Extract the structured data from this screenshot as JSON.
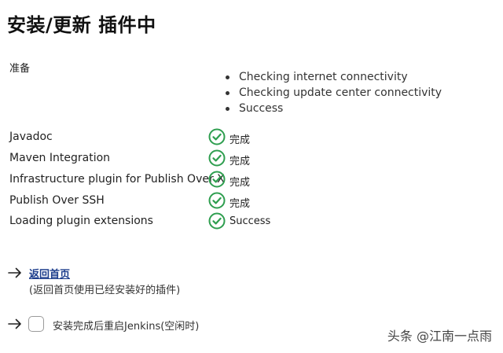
{
  "page_title": "安装/更新 插件中",
  "preparation": {
    "label": "准备",
    "steps": [
      "Checking internet connectivity",
      "Checking update center connectivity",
      "Success"
    ]
  },
  "plugins": [
    {
      "name": "Javadoc",
      "status": "完成",
      "status_icon": "check-circle-icon"
    },
    {
      "name": "Maven Integration",
      "status": "完成",
      "status_icon": "check-circle-icon"
    },
    {
      "name": "Infrastructure plugin for Publish Over X",
      "status": "完成",
      "status_icon": "check-circle-icon"
    },
    {
      "name": "Publish Over SSH",
      "status": "完成",
      "status_icon": "check-circle-icon"
    },
    {
      "name": "Loading plugin extensions",
      "status": "Success",
      "status_icon": "check-circle-icon"
    }
  ],
  "back": {
    "link_label": "返回首页",
    "description": "(返回首页使用已经安装好的插件)"
  },
  "restart": {
    "label": "安装完成后重启Jenkins(空闲时)",
    "checked": false
  },
  "watermark": "头条 @江南一点雨",
  "colors": {
    "success_green": "#2e9e4f",
    "link_blue": "#1c3d8c"
  }
}
